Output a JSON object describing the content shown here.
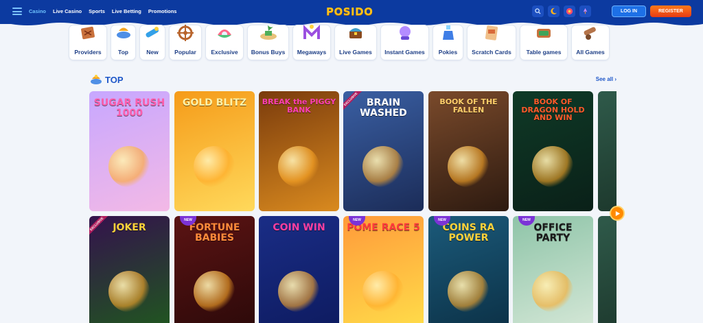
{
  "header": {
    "nav": [
      "Casino",
      "Live Casino",
      "Sports",
      "Live Betting",
      "Promotions"
    ],
    "logo": "POSIDO",
    "login_label": "LOG IN",
    "register_label": "REGISTER",
    "icons": [
      "search-icon",
      "crescent-icon",
      "wheel-icon",
      "rocket-icon"
    ]
  },
  "categories": [
    {
      "label": "Providers",
      "icon": "treasure-map-icon"
    },
    {
      "label": "Top",
      "icon": "genie-lamp-icon"
    },
    {
      "label": "New",
      "icon": "telescope-icon"
    },
    {
      "label": "Popular",
      "icon": "ship-wheel-icon"
    },
    {
      "label": "Exclusive",
      "icon": "clam-pearl-icon"
    },
    {
      "label": "Bonus Buys",
      "icon": "treasure-island-icon"
    },
    {
      "label": "Megaways",
      "icon": "trident-m-icon"
    },
    {
      "label": "Live Games",
      "icon": "treasure-chest-icon"
    },
    {
      "label": "Instant Games",
      "icon": "crystal-ball-icon"
    },
    {
      "label": "Pokies",
      "icon": "potion-bottle-icon"
    },
    {
      "label": "Scratch Cards",
      "icon": "scratch-card-icon"
    },
    {
      "label": "Table games",
      "icon": "casino-table-icon"
    },
    {
      "label": "All Games",
      "icon": "cannon-icon"
    }
  ],
  "section": {
    "title": "TOP",
    "see_all": "See all ›"
  },
  "games": [
    {
      "title": "SUGAR RUSH 1000",
      "badge": "",
      "colors": [
        "#c7a7ff",
        "#f3b9e6"
      ],
      "title_color": "#ff5fae"
    },
    {
      "title": "GOLD BLITZ",
      "badge": "",
      "colors": [
        "#f59b19",
        "#ffd95b"
      ],
      "title_color": "#fff2a8"
    },
    {
      "title": "BREAK the PIGGY BANK",
      "badge": "",
      "colors": [
        "#7a3b0c",
        "#d98a1f"
      ],
      "title_color": "#ff3fb3"
    },
    {
      "title": "BRAIN WASHED",
      "badge": "EXCLUSIVE",
      "colors": [
        "#3a5fa3",
        "#1b2c58"
      ],
      "title_color": "#ffffff"
    },
    {
      "title": "BOOK OF THE FALLEN",
      "badge": "",
      "colors": [
        "#7a4a2b",
        "#2d1a10"
      ],
      "title_color": "#ffcf6a"
    },
    {
      "title": "BOOK OF DRAGON HOLD AND WIN",
      "badge": "",
      "colors": [
        "#0f3a27",
        "#0a2018"
      ],
      "title_color": "#ff5a2a"
    },
    {
      "title": "JOKER",
      "badge": "EXCLUSIVE",
      "colors": [
        "#34124d",
        "#1f5a1d"
      ],
      "title_color": "#ffd23a"
    },
    {
      "title": "FORTUNE BABIES",
      "badge": "NEW",
      "colors": [
        "#5b1313",
        "#2a0909"
      ],
      "title_color": "#ff8a3a"
    },
    {
      "title": "COIN WIN",
      "badge": "",
      "colors": [
        "#1a2d86",
        "#0d1a5e"
      ],
      "title_color": "#ff3fa0"
    },
    {
      "title": "POME RACE 5",
      "badge": "NEW",
      "colors": [
        "#ff9a3a",
        "#ffe04a"
      ],
      "title_color": "#ff3b3b"
    },
    {
      "title": "COINS RA POWER",
      "badge": "NEW",
      "colors": [
        "#1b5a7a",
        "#0b2f44"
      ],
      "title_color": "#ffd23a"
    },
    {
      "title": "OFFICE PARTY",
      "badge": "NEW",
      "colors": [
        "#8ec4a8",
        "#d8e9d9"
      ],
      "title_color": "#1b1b1b"
    }
  ]
}
